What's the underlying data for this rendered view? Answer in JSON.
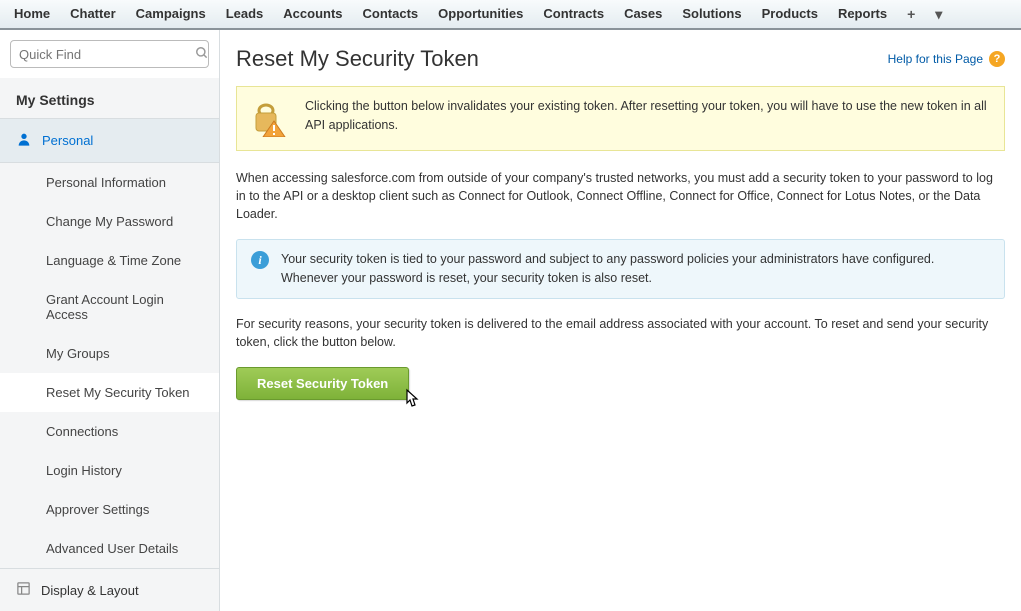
{
  "topnav": {
    "tabs": [
      "Home",
      "Chatter",
      "Campaigns",
      "Leads",
      "Accounts",
      "Contacts",
      "Opportunities",
      "Contracts",
      "Cases",
      "Solutions",
      "Products",
      "Reports"
    ]
  },
  "sidebar": {
    "search_placeholder": "Quick Find",
    "section_title": "My Settings",
    "category_personal_label": "Personal",
    "personal_items": [
      "Personal Information",
      "Change My Password",
      "Language & Time Zone",
      "Grant Account Login Access",
      "My Groups",
      "Reset My Security Token",
      "Connections",
      "Login History",
      "Approver Settings",
      "Advanced User Details"
    ],
    "active_item_index": 5,
    "category_display_label": "Display & Layout"
  },
  "main": {
    "page_title": "Reset My Security Token",
    "help_label": "Help for this Page",
    "warning": "Clicking the button below invalidates your existing token. After resetting your token, you will have to use the new token in all API applications.",
    "para1": "When accessing salesforce.com from outside of your company's trusted networks, you must add a security token to your password to log in to the API or a desktop client such as Connect for Outlook, Connect Offline, Connect for Office, Connect for Lotus Notes, or the Data Loader.",
    "info": "Your security token is tied to your password and subject to any password policies your administrators have configured. Whenever your password is reset, your security token is also reset.",
    "para2": "For security reasons, your security token is delivered to the email address associated with your account. To reset and send your security token, click the button below.",
    "button_label": "Reset Security Token"
  }
}
